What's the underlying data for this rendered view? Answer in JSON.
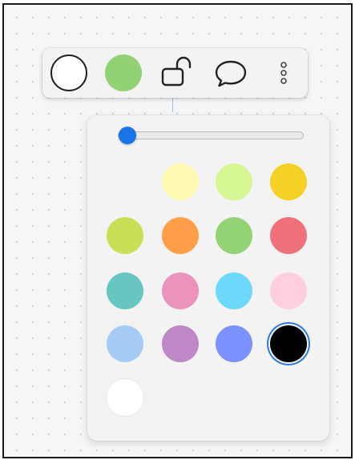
{
  "toolbar": {
    "outline_color": "#ffffff",
    "fill_color": "#93d274",
    "lock_state": "unlocked",
    "icons": [
      "circle-outline-icon",
      "filled-circle-icon",
      "unlock-icon",
      "comment-icon",
      "more-vertical-icon"
    ]
  },
  "color_panel": {
    "opacity_percent": 5,
    "selected_color": "#000000",
    "colors": [
      [
        null,
        "#fff9b1",
        "#d5f692",
        "#f5d128"
      ],
      [
        "#c9df56",
        "#ff9d48",
        "#93d275",
        "#f0707c"
      ],
      [
        "#67c6c0",
        "#ea94bb",
        "#6cd8fa",
        "#ffcee0"
      ],
      [
        "#a6ccf5",
        "#be88c7",
        "#7b92ff",
        "#000000"
      ],
      [
        "#ffffff",
        null,
        null,
        null
      ]
    ]
  }
}
